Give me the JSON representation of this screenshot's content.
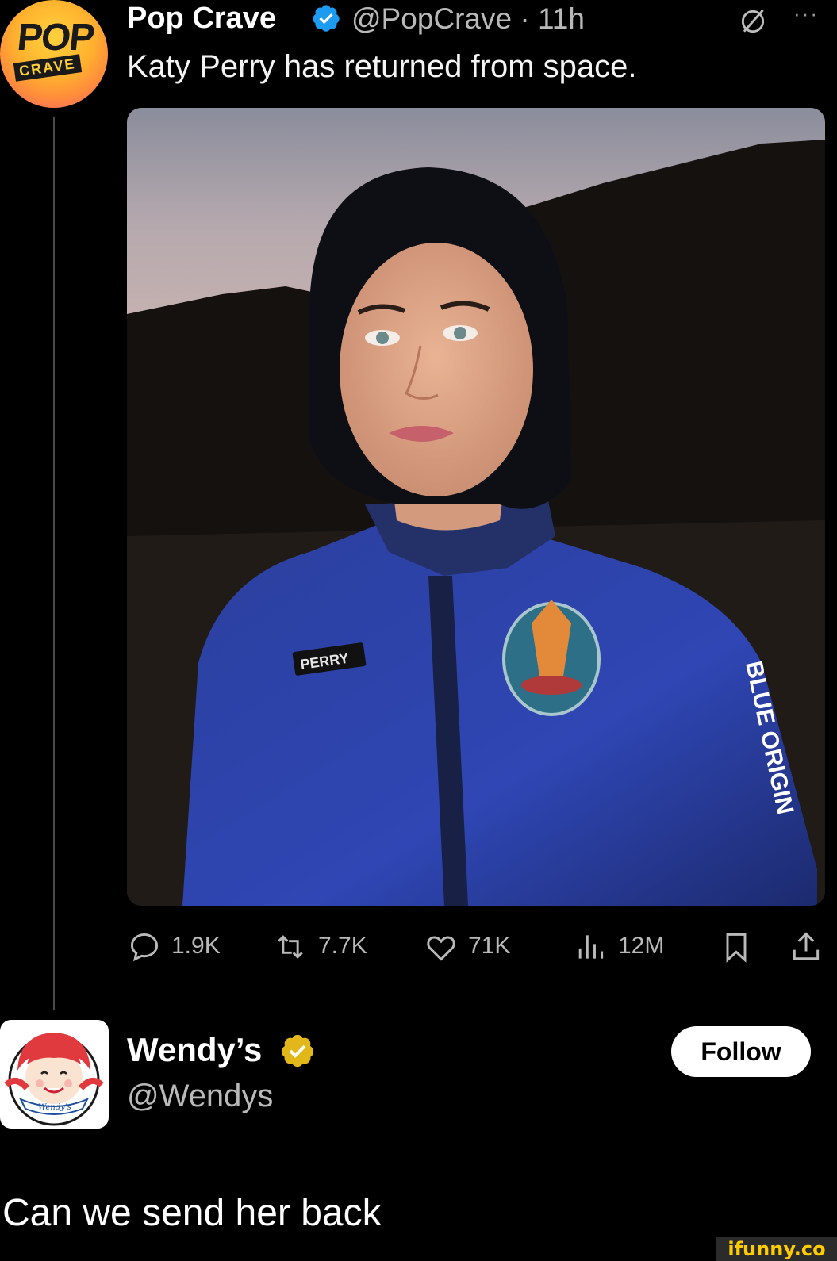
{
  "tweet": {
    "author_name": "Pop Crave",
    "author_handle": "@PopCrave",
    "time": "· 11h",
    "text": "Katy Perry has returned from space.",
    "avatar_text_top": "POP",
    "avatar_text_bottom": "CRAVE",
    "photo_alt": "Katy Perry in a blue flight suit in front of mountains at dusk",
    "photo_name_tag": "PERRY",
    "photo_sleeve_text": "BLUE ORIGIN",
    "stats": {
      "replies": "1.9K",
      "reposts": "7.7K",
      "likes": "71K",
      "views": "12M"
    }
  },
  "reply": {
    "author_name": "Wendy’s",
    "author_handle": "@Wendys",
    "follow_label": "Follow",
    "text": "Can we send her back",
    "avatar_text": "Wendy's"
  },
  "watermark": "ifunny.co",
  "colors": {
    "verified_blue": "#1d9bf0",
    "verified_gold": "#e2b719",
    "muted_text": "#b9b9b9",
    "background": "#000000"
  }
}
